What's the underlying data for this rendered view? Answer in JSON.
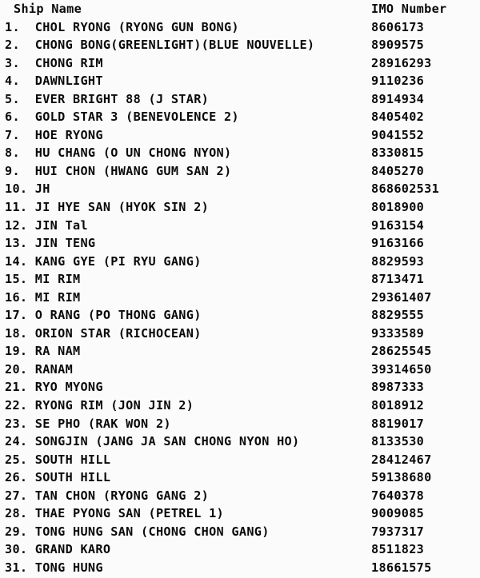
{
  "document": {
    "type": "ship-registry-list",
    "columns": {
      "name_header": "Ship Name",
      "imo_header": "IMO Number"
    },
    "row_count": 31,
    "colors": {
      "background": "#fbfbfb",
      "text": "#0a0a0a"
    }
  },
  "rows": [
    {
      "index": "1.",
      "name": "CHOL RYONG (RYONG GUN BONG)",
      "imo": "8606173"
    },
    {
      "index": "2.",
      "name": "CHONG BONG(GREENLIGHT)(BLUE NOUVELLE)",
      "imo": "8909575"
    },
    {
      "index": "3.",
      "name": "CHONG RIM",
      "imo": "28916293"
    },
    {
      "index": "4.",
      "name": "DAWNLIGHT",
      "imo": "9110236"
    },
    {
      "index": "5.",
      "name": "EVER BRIGHT 88 (J STAR)",
      "imo": "8914934"
    },
    {
      "index": "6.",
      "name": "GOLD STAR 3 (BENEVOLENCE 2)",
      "imo": "8405402"
    },
    {
      "index": "7.",
      "name": "HOE RYONG",
      "imo": "9041552"
    },
    {
      "index": "8.",
      "name": "HU CHANG (O UN CHONG NYON)",
      "imo": "8330815"
    },
    {
      "index": "9.",
      "name": "HUI CHON (HWANG GUM SAN 2)",
      "imo": "8405270"
    },
    {
      "index": "10.",
      "name": "JH",
      "imo": "868602531"
    },
    {
      "index": "11.",
      "name": "JI HYE SAN (HYOK SIN 2)",
      "imo": "8018900"
    },
    {
      "index": "12.",
      "name": "JIN Tal",
      "imo": "9163154"
    },
    {
      "index": "13.",
      "name": "JIN TENG",
      "imo": "9163166"
    },
    {
      "index": "14.",
      "name": "KANG GYE (PI RYU GANG)",
      "imo": "8829593"
    },
    {
      "index": "15.",
      "name": "MI RIM",
      "imo": "8713471"
    },
    {
      "index": "16.",
      "name": "MI RIM",
      "imo": "29361407"
    },
    {
      "index": "17.",
      "name": "O RANG (PO THONG GANG)",
      "imo": "8829555"
    },
    {
      "index": "18.",
      "name": "ORION STAR (RICHOCEAN)",
      "imo": "9333589"
    },
    {
      "index": "19.",
      "name": "RA NAM",
      "imo": "28625545"
    },
    {
      "index": "20.",
      "name": "RANAM",
      "imo": "39314650"
    },
    {
      "index": "21.",
      "name": "RYO MYONG",
      "imo": "8987333"
    },
    {
      "index": "22.",
      "name": "RYONG RIM (JON JIN 2)",
      "imo": "8018912"
    },
    {
      "index": "23.",
      "name": "SE PHO (RAK WON 2)",
      "imo": "8819017"
    },
    {
      "index": "24.",
      "name": "SONGJIN (JANG JA SAN CHONG NYON HO)",
      "imo": "8133530"
    },
    {
      "index": "25.",
      "name": "SOUTH HILL",
      "imo": "28412467"
    },
    {
      "index": "26.",
      "name": "SOUTH HILL",
      "imo": "59138680"
    },
    {
      "index": "27.",
      "name": "TAN CHON (RYONG GANG 2)",
      "imo": "7640378"
    },
    {
      "index": "28.",
      "name": "THAE PYONG SAN (PETREL 1)",
      "imo": "9009085"
    },
    {
      "index": "29.",
      "name": "TONG HUNG SAN (CHONG CHON GANG)",
      "imo": "7937317"
    },
    {
      "index": "30.",
      "name": "GRAND KARO",
      "imo": "8511823"
    },
    {
      "index": "31.",
      "name": "TONG HUNG",
      "imo": "18661575"
    }
  ]
}
